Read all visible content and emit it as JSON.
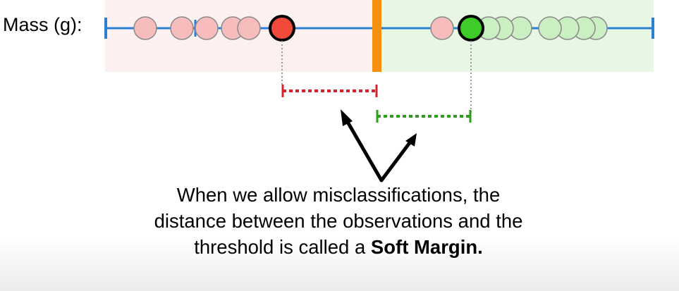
{
  "axis_label": "Mass (g):",
  "caption": {
    "line1": "When we allow misclassifications, the",
    "line2": "distance between the observations and the",
    "line3_start": "threshold is called a",
    "line3_bold": "Soft Margin."
  },
  "colors": {
    "class_a_fill": "#f7bcbc",
    "class_a_support": "#f04a3a",
    "class_a_region": "#fdf0f0",
    "class_b_fill": "#c9efc2",
    "class_b_support": "#3dcc28",
    "class_b_region": "#e8f7e3",
    "threshold": "#f5900f",
    "axis": "#2d7fd6",
    "margin_a": "#d8212b",
    "margin_b": "#2f9e1e"
  }
}
